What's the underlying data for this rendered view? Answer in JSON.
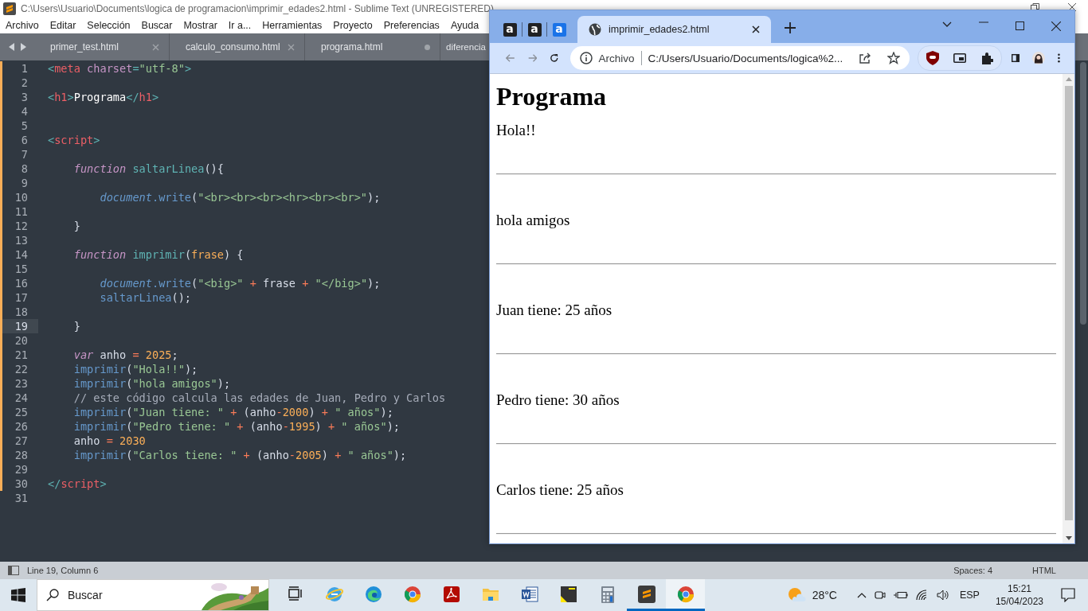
{
  "editor": {
    "title": "C:\\Users\\Usuario\\Documents\\logica de programacion\\imprimir_edades2.html - Sublime Text (UNREGISTERED)",
    "menu": [
      "Archivo",
      "Editar",
      "Selección",
      "Buscar",
      "Mostrar",
      "Ir a...",
      "Herramientas",
      "Proyecto",
      "Preferencias",
      "Ayuda"
    ],
    "tabs": [
      {
        "label": "primer_test.html",
        "modified": false
      },
      {
        "label": "calculo_consumo.html",
        "modified": false
      },
      {
        "label": "programa.html",
        "modified": true
      },
      {
        "label": "diferencia"
      }
    ],
    "lines": [
      {
        "number": "1",
        "current": false,
        "changed": true,
        "tokens": [
          {
            "kind": "punct",
            "text": "<"
          },
          {
            "kind": "tag",
            "text": "meta"
          },
          {
            "kind": "attr",
            "text": " charset"
          },
          {
            "kind": "punct",
            "text": "="
          },
          {
            "kind": "str",
            "text": "\"utf-8\""
          },
          {
            "kind": "punct",
            "text": ">"
          }
        ]
      },
      {
        "number": "2",
        "current": false,
        "changed": true
      },
      {
        "number": "3",
        "current": false,
        "changed": true,
        "tokens": [
          {
            "kind": "punct",
            "text": "<"
          },
          {
            "kind": "tag",
            "text": "h1"
          },
          {
            "kind": "punct",
            "text": ">"
          },
          {
            "kind": "txt",
            "text": "Programa"
          },
          {
            "kind": "punct",
            "text": "</"
          },
          {
            "kind": "tag",
            "text": "h1"
          },
          {
            "kind": "punct",
            "text": ">"
          }
        ]
      },
      {
        "number": "4",
        "current": false,
        "changed": true
      },
      {
        "number": "5",
        "current": false,
        "changed": true
      },
      {
        "number": "6",
        "current": false,
        "changed": true,
        "tokens": [
          {
            "kind": "punct",
            "text": "<"
          },
          {
            "kind": "tag",
            "text": "script"
          },
          {
            "kind": "punct",
            "text": ">"
          }
        ],
        "children": [
          {
            "number": "7",
            "current": false,
            "changed": true
          },
          {
            "number": "8",
            "current": false,
            "changed": true,
            "tokens": [
              {
                "kind": "kw",
                "text": "function"
              },
              {
                "kind": "fn",
                "text": " saltarLinea"
              },
              {
                "kind": "p",
                "text": "(){"
              }
            ],
            "children": [
              {
                "number": "9",
                "current": false,
                "changed": true
              },
              {
                "number": "10",
                "current": false,
                "changed": true,
                "tokens": [
                  {
                    "kind": "obj",
                    "text": "document"
                  },
                  {
                    "kind": "meth",
                    "text": ".write"
                  },
                  {
                    "kind": "p",
                    "text": "("
                  },
                  {
                    "kind": "str",
                    "text": "\"<br><br><br><hr><br><br>\""
                  },
                  {
                    "kind": "p",
                    "text": ");"
                  }
                ]
              },
              {
                "number": "11",
                "current": false,
                "changed": true
              }
            ]
          },
          {
            "number": "12",
            "current": false,
            "changed": true,
            "tokens": [
              {
                "kind": "p",
                "text": "}"
              }
            ]
          },
          {
            "number": "13",
            "current": false,
            "changed": true
          },
          {
            "number": "14",
            "current": false,
            "changed": true,
            "tokens": [
              {
                "kind": "kw",
                "text": "function"
              },
              {
                "kind": "fn",
                "text": " imprimir"
              },
              {
                "kind": "p",
                "text": "("
              },
              {
                "kind": "param",
                "text": "frase"
              },
              {
                "kind": "p",
                "text": ") {"
              }
            ],
            "children": [
              {
                "number": "15",
                "current": false,
                "changed": true
              },
              {
                "number": "16",
                "current": false,
                "changed": true,
                "tokens": [
                  {
                    "kind": "obj",
                    "text": "document"
                  },
                  {
                    "kind": "meth",
                    "text": ".write"
                  },
                  {
                    "kind": "p",
                    "text": "("
                  },
                  {
                    "kind": "str",
                    "text": "\"<big>\""
                  },
                  {
                    "kind": "op",
                    "text": " +"
                  },
                  {
                    "kind": "p",
                    "text": " frase"
                  },
                  {
                    "kind": "op",
                    "text": " +"
                  },
                  {
                    "kind": "str",
                    "text": " \"</big>\""
                  },
                  {
                    "kind": "p",
                    "text": ");"
                  }
                ]
              },
              {
                "number": "17",
                "current": false,
                "changed": true,
                "tokens": [
                  {
                    "kind": "call",
                    "text": "saltarLinea"
                  },
                  {
                    "kind": "p",
                    "text": "();"
                  }
                ]
              },
              {
                "number": "18",
                "current": false,
                "changed": true
              }
            ]
          },
          {
            "number": "19",
            "current": true,
            "changed": true,
            "tokens": [
              {
                "kind": "p",
                "text": "}"
              }
            ]
          },
          {
            "number": "20",
            "current": false,
            "changed": true
          },
          {
            "number": "21",
            "current": false,
            "changed": true,
            "tokens": [
              {
                "kind": "kw",
                "text": "var"
              },
              {
                "kind": "p",
                "text": " anho"
              },
              {
                "kind": "op",
                "text": " ="
              },
              {
                "kind": "num",
                "text": " 2025"
              },
              {
                "kind": "p",
                "text": ";"
              }
            ]
          },
          {
            "number": "22",
            "current": false,
            "changed": true,
            "tokens": [
              {
                "kind": "call",
                "text": "imprimir"
              },
              {
                "kind": "p",
                "text": "("
              },
              {
                "kind": "str",
                "text": "\"Hola!!\""
              },
              {
                "kind": "p",
                "text": ");"
              }
            ]
          },
          {
            "number": "23",
            "current": false,
            "changed": true,
            "tokens": [
              {
                "kind": "call",
                "text": "imprimir"
              },
              {
                "kind": "p",
                "text": "("
              },
              {
                "kind": "str",
                "text": "\"hola amigos\""
              },
              {
                "kind": "p",
                "text": ");"
              }
            ]
          },
          {
            "number": "24",
            "current": false,
            "changed": true,
            "tokens": [
              {
                "kind": "cm",
                "text": "// este código calcula las edades de Juan, Pedro y Carlos"
              }
            ]
          },
          {
            "number": "25",
            "current": false,
            "changed": true,
            "tokens": [
              {
                "kind": "call",
                "text": "imprimir"
              },
              {
                "kind": "p",
                "text": "("
              },
              {
                "kind": "str",
                "text": "\"Juan tiene: \""
              },
              {
                "kind": "op",
                "text": " +"
              },
              {
                "kind": "p",
                "text": " (anho"
              },
              {
                "kind": "op",
                "text": "-"
              },
              {
                "kind": "num",
                "text": "2000"
              },
              {
                "kind": "p",
                "text": ")"
              },
              {
                "kind": "op",
                "text": " +"
              },
              {
                "kind": "str",
                "text": " \" años\""
              },
              {
                "kind": "p",
                "text": ");"
              }
            ]
          },
          {
            "number": "26",
            "current": false,
            "changed": true,
            "tokens": [
              {
                "kind": "call",
                "text": "imprimir"
              },
              {
                "kind": "p",
                "text": "("
              },
              {
                "kind": "str",
                "text": "\"Pedro tiene: \""
              },
              {
                "kind": "op",
                "text": " +"
              },
              {
                "kind": "p",
                "text": " (anho"
              },
              {
                "kind": "op",
                "text": "-"
              },
              {
                "kind": "num",
                "text": "1995"
              },
              {
                "kind": "p",
                "text": ")"
              },
              {
                "kind": "op",
                "text": " +"
              },
              {
                "kind": "str",
                "text": " \" años\""
              },
              {
                "kind": "p",
                "text": ");"
              }
            ]
          },
          {
            "number": "27",
            "current": false,
            "changed": true,
            "tokens": [
              {
                "kind": "p",
                "text": "anho"
              },
              {
                "kind": "op",
                "text": " ="
              },
              {
                "kind": "num",
                "text": " 2030"
              }
            ]
          },
          {
            "number": "28",
            "current": false,
            "changed": true,
            "tokens": [
              {
                "kind": "call",
                "text": "imprimir"
              },
              {
                "kind": "p",
                "text": "("
              },
              {
                "kind": "str",
                "text": "\"Carlos tiene: \""
              },
              {
                "kind": "op",
                "text": " +"
              },
              {
                "kind": "p",
                "text": " (anho"
              },
              {
                "kind": "op",
                "text": "-"
              },
              {
                "kind": "num",
                "text": "2005"
              },
              {
                "kind": "p",
                "text": ")"
              },
              {
                "kind": "op",
                "text": " +"
              },
              {
                "kind": "str",
                "text": " \" años\""
              },
              {
                "kind": "p",
                "text": ");"
              }
            ]
          },
          {
            "number": "29",
            "current": false,
            "changed": true
          }
        ]
      },
      {
        "number": "30",
        "current": false,
        "changed": true,
        "tokens": [
          {
            "kind": "punct",
            "text": "</"
          },
          {
            "kind": "tag",
            "text": "script"
          },
          {
            "kind": "punct",
            "text": ">"
          }
        ]
      },
      {
        "number": "31",
        "current": false,
        "changed": false
      }
    ],
    "status_bar": {
      "position": "Line 19, Column 6",
      "indent": "Spaces: 4",
      "syntax": "HTML"
    }
  },
  "browser": {
    "tabs": [
      {
        "kind": "pinned",
        "label": "a",
        "color": "#202124",
        "selected": false
      },
      {
        "kind": "pinned",
        "label": "a",
        "color": "#202124",
        "selected": false
      },
      {
        "kind": "pinned",
        "label": "a",
        "color": "#1a73e8",
        "selected": false
      },
      {
        "kind": "page",
        "label": "imprimir_edades2.html",
        "selected": true
      }
    ],
    "address": {
      "scheme": "Archivo",
      "url": "C:/Users/Usuario/Documents/logica%2..."
    },
    "page": {
      "heading": "Programa",
      "outputs": [
        "Hola!!",
        "hola amigos",
        "Juan tiene: 25 años",
        "Pedro tiene: 30 años",
        "Carlos tiene: 25 años"
      ]
    }
  },
  "taskbar": {
    "search": {
      "placeholder": "Buscar"
    },
    "apps": [
      {
        "kind": "task-view",
        "running": false,
        "selected": false
      },
      {
        "kind": "ie",
        "running": false,
        "selected": false
      },
      {
        "kind": "edge",
        "running": false,
        "selected": false
      },
      {
        "kind": "chrome",
        "running": false,
        "selected": false
      },
      {
        "kind": "acrobat",
        "running": false,
        "selected": false
      },
      {
        "kind": "folder",
        "running": false,
        "selected": false
      },
      {
        "kind": "word",
        "running": false,
        "selected": false
      },
      {
        "kind": "sticky",
        "running": false,
        "selected": false
      },
      {
        "kind": "calculator",
        "running": false,
        "selected": false
      },
      {
        "kind": "sublime",
        "running": true,
        "selected": false
      },
      {
        "kind": "chrome",
        "running": true,
        "selected": true
      }
    ],
    "weather": "28°C",
    "language": "ESP",
    "time": "15:21",
    "date": "15/04/2023"
  }
}
